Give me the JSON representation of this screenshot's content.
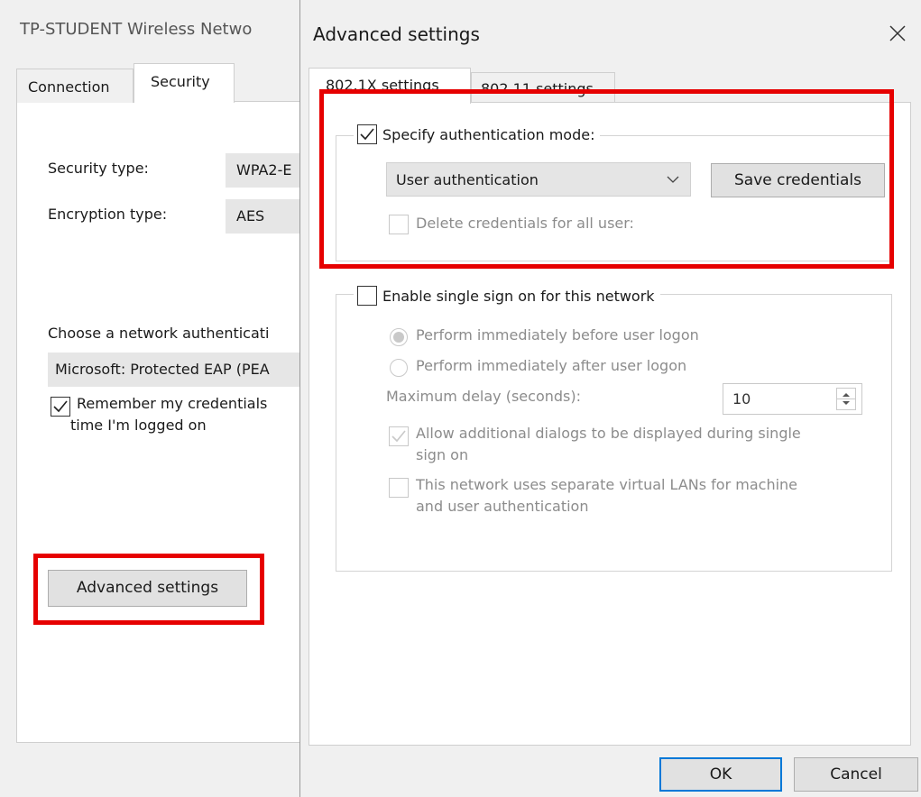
{
  "background_window": {
    "title": "TP-STUDENT Wireless Netwo",
    "tabs": [
      {
        "label": "Connection"
      },
      {
        "label": "Security"
      }
    ],
    "security_type_label": "Security type:",
    "security_type_value": "WPA2-E",
    "encryption_type_label": "Encryption type:",
    "encryption_type_value": "AES",
    "auth_method_label": "Choose a network authenticati",
    "auth_method_value": "Microsoft: Protected EAP (PEA",
    "remember_credentials_line1": "Remember my credentials",
    "remember_credentials_line2": "time I'm logged on",
    "advanced_settings_button": "Advanced settings"
  },
  "dialog": {
    "title": "Advanced settings",
    "tabs": [
      {
        "label": "802.1X settings"
      },
      {
        "label": "802.11 settings"
      }
    ],
    "specify_auth_mode_label": "Specify authentication mode:",
    "auth_mode_selected": "User authentication",
    "save_credentials_button": "Save credentials",
    "delete_credentials_label": "Delete credentials for all user:",
    "sso_label": "Enable single sign on for this network",
    "perform_before_logon": "Perform immediately before user logon",
    "perform_after_logon": "Perform immediately after user logon",
    "max_delay_label": "Maximum delay (seconds):",
    "max_delay_value": "10",
    "allow_dialogs_line1": "Allow additional dialogs to be displayed during single",
    "allow_dialogs_line2": "sign on",
    "vlan_line1": "This network uses separate virtual LANs for machine",
    "vlan_line2": "and user authentication",
    "ok_button": "OK",
    "cancel_button": "Cancel"
  },
  "colors": {
    "highlight_red": "#e60000",
    "default_button_border": "#0078d7",
    "disabled_text": "#8c8c8c"
  },
  "icons": {
    "close": "close-icon",
    "dropdown": "chevron-down-icon",
    "spinner": "spinner-arrows-icon",
    "check": "checkmark-icon"
  }
}
